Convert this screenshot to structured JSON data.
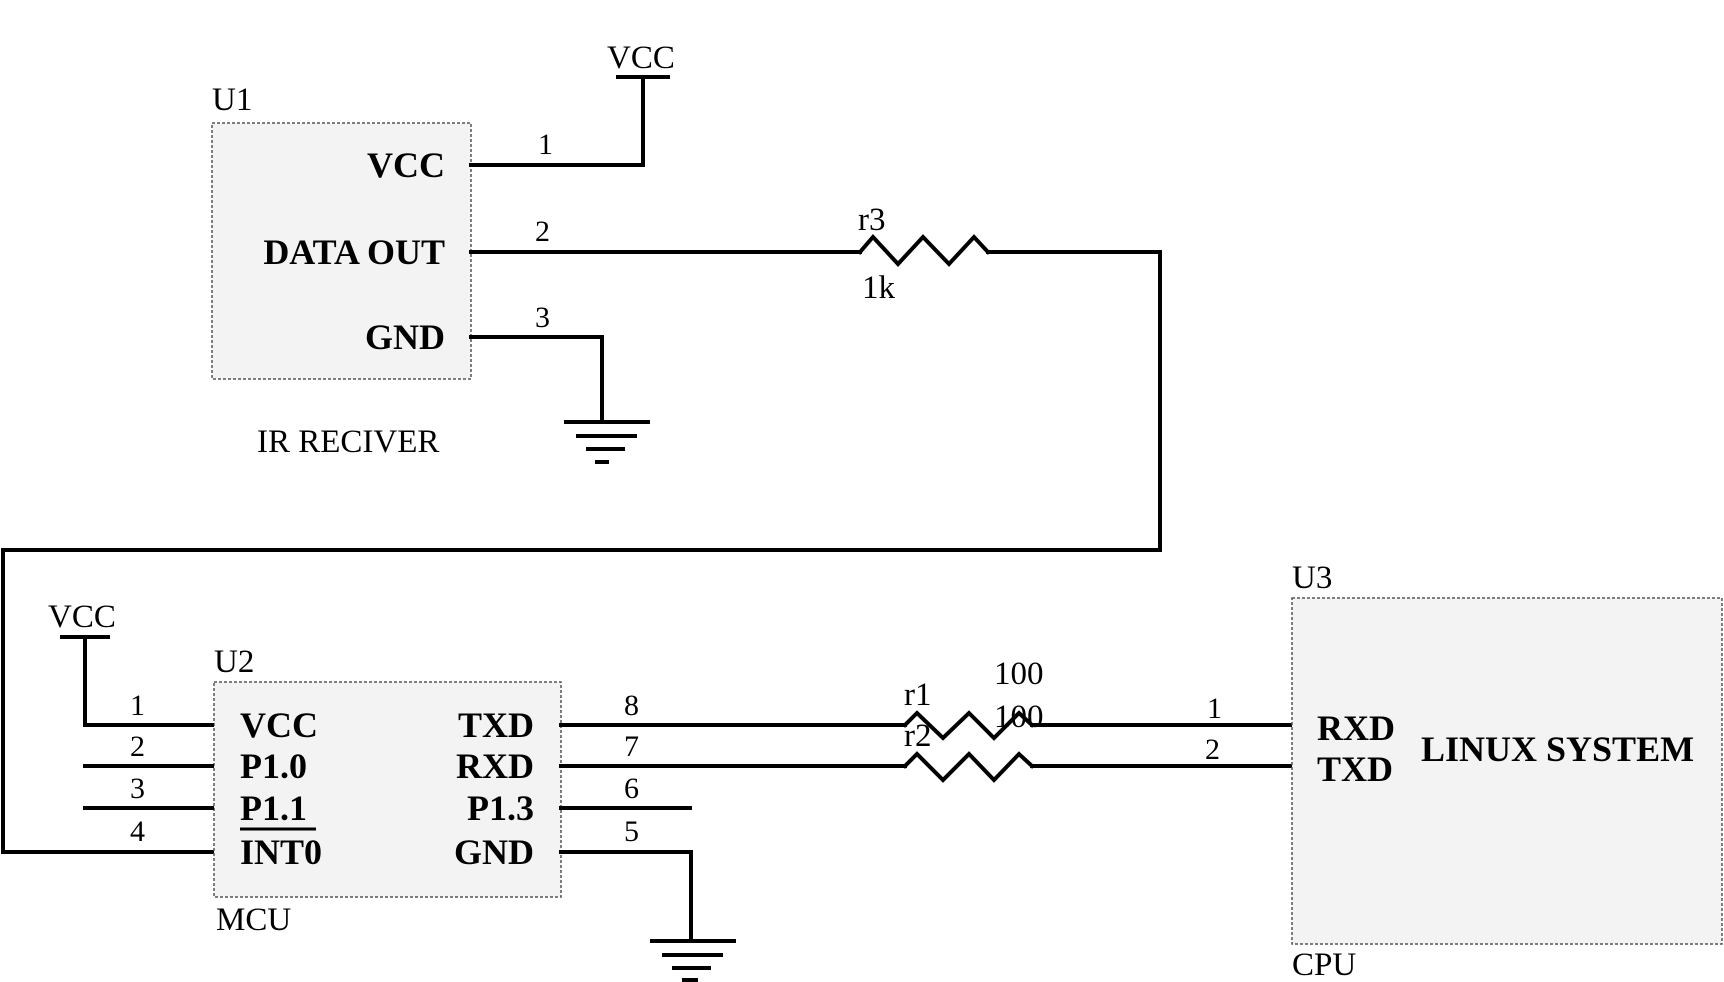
{
  "diagram": {
    "type": "circuit-schematic",
    "colors": {
      "ink": "#000000",
      "component_fill": "#f3f3f3",
      "background": "#ffffff"
    },
    "components": {
      "u1": {
        "ref": "U1",
        "name": "IR RECIVER",
        "pins": [
          {
            "num": "1",
            "label": "VCC"
          },
          {
            "num": "2",
            "label": "DATA OUT"
          },
          {
            "num": "3",
            "label": "GND"
          }
        ]
      },
      "u2": {
        "ref": "U2",
        "name": "MCU",
        "left_pins": [
          {
            "num": "1",
            "label": "VCC"
          },
          {
            "num": "2",
            "label": "P1.0"
          },
          {
            "num": "3",
            "label": "P1.1"
          },
          {
            "num": "4",
            "label": "INT0"
          }
        ],
        "right_pins": [
          {
            "num": "8",
            "label": "TXD"
          },
          {
            "num": "7",
            "label": "RXD"
          },
          {
            "num": "6",
            "label": "P1.3"
          },
          {
            "num": "5",
            "label": "GND"
          }
        ]
      },
      "u3": {
        "ref": "U3",
        "name": "CPU",
        "body_text": "LINUX SYSTEM",
        "pins": [
          {
            "num": "1",
            "label": "RXD"
          },
          {
            "num": "2",
            "label": "TXD"
          }
        ]
      },
      "r1": {
        "ref": "r1",
        "value": "100"
      },
      "r2": {
        "ref": "r2",
        "value": "100"
      },
      "r3": {
        "ref": "r3",
        "value": "1k"
      }
    },
    "power": {
      "vcc_top": "VCC",
      "vcc_left": "VCC"
    },
    "nets": [
      {
        "from": "U1.1 VCC",
        "to": "VCC"
      },
      {
        "from": "U1.2 DATA OUT",
        "via": "r3",
        "to": "U2.4 INT0"
      },
      {
        "from": "U1.3 GND",
        "to": "GND"
      },
      {
        "from": "U2.1 VCC",
        "to": "VCC"
      },
      {
        "from": "U2.8 TXD",
        "via": "r1",
        "to": "U3.1 RXD"
      },
      {
        "from": "U2.7 RXD",
        "via": "r2",
        "to": "U3.2 TXD"
      },
      {
        "from": "U2.5 GND",
        "to": "GND"
      }
    ]
  }
}
